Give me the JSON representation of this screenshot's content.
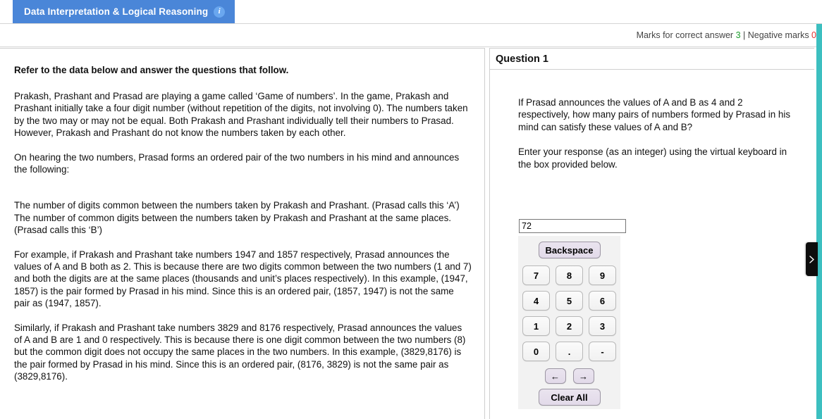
{
  "section_tab": {
    "label": "Data Interpretation & Logical Reasoning",
    "info_icon": "info-icon",
    "info_glyph": "i",
    "color": "#4a86d8"
  },
  "marks_bar": {
    "correct_prefix": "Marks for correct answer ",
    "correct_value": "3",
    "separator": " | ",
    "negative_prefix": "Negative marks ",
    "negative_value": "0",
    "positive_color": "#1a9d2c",
    "negative_color": "#e03030"
  },
  "passage": {
    "heading": "Refer to the data below and answer the questions that follow.",
    "paragraphs": [
      "Prakash, Prashant and Prasad are playing a game called ‘Game of numbers’. In the game, Prakash and Prashant initially take a four digit number (without repetition of the digits, not involving 0). The numbers taken by the two may or may not be equal. Both Prakash and Prashant individually tell their numbers to Prasad. However, Prakash and Prashant do not know the numbers taken by each other.",
      "On hearing the two numbers, Prasad forms an ordered pair of the two numbers in his mind and announces the following:",
      "The number of digits common between the numbers taken by Prakash and Prashant. (Prasad calls this ‘A’)",
      "The number of common digits between the numbers taken by Prakash and Prashant at the same places. (Prasad calls this ‘B’)",
      "For example, if Prakash and Prashant take numbers 1947 and 1857 respectively, Prasad announces the values of A and B both as 2. This is because there are two digits common between the two numbers (1 and 7) and both the digits are at the same places (thousands and unit’s places respectively). In this example, (1947, 1857) is the pair formed by Prasad in his mind. Since this is an ordered pair, (1857, 1947) is not the same pair as (1947, 1857).",
      "Similarly, if Prakash and Prashant take numbers 3829 and 8176 respectively, Prasad announces the values of A and B are 1 and 0 respectively. This is because there is one digit common between the two numbers (8) but the common digit does not occupy the same places in the two numbers. In this example, (3829,8176) is the pair formed by Prasad in his mind. Since this is an ordered pair, (8176, 3829) is not the same pair as (3829,8176)."
    ]
  },
  "question": {
    "title": "Question 1",
    "text": "If Prasad announces the values of A and B as 4 and 2 respectively, how many pairs of numbers formed by Prasad in his mind can satisfy these values of A and B?",
    "instruction": "Enter your response (as an integer) using the virtual keyboard in the box provided below."
  },
  "answer": {
    "value": "72",
    "placeholder": ""
  },
  "keypad": {
    "backspace_label": "Backspace",
    "rows": [
      [
        "7",
        "8",
        "9"
      ],
      [
        "4",
        "5",
        "6"
      ],
      [
        "1",
        "2",
        "3"
      ],
      [
        "0",
        ".",
        "-"
      ]
    ],
    "left_arrow_label": "←",
    "right_arrow_label": "→",
    "clear_all_label": "Clear All",
    "background": "#f2f2f2"
  },
  "rail": {
    "color": "#3cbfc0",
    "handle_icon": "chevron-right-icon"
  }
}
